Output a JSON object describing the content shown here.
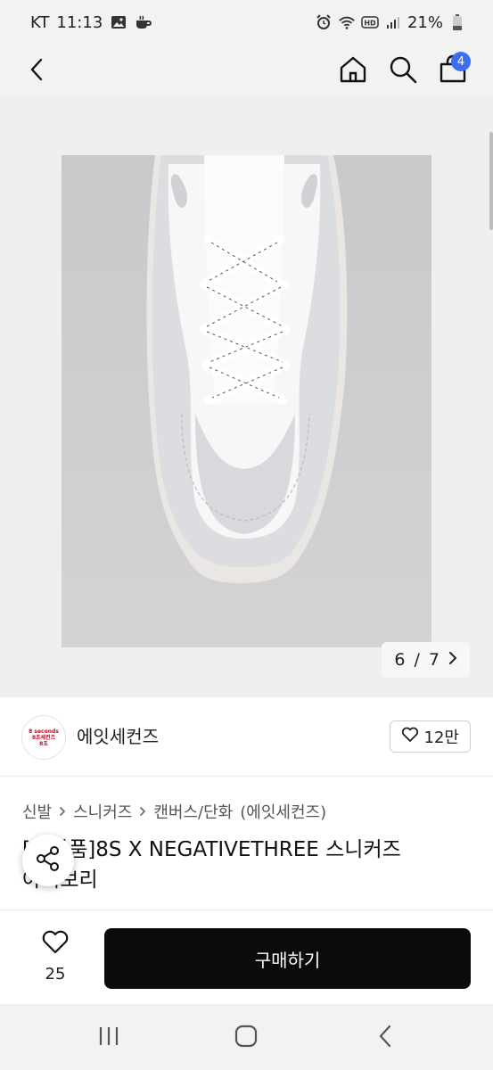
{
  "status_bar": {
    "carrier": "KT",
    "time": "11:13",
    "battery": "21%",
    "icons": [
      "image-icon",
      "coffee-icon",
      "alarm-icon",
      "wifi-icon",
      "hd-icon",
      "signal-icon",
      "battery-icon"
    ]
  },
  "nav": {
    "icons": [
      "back-icon",
      "home-icon",
      "search-icon",
      "cart-icon"
    ],
    "cart_count": "4"
  },
  "gallery": {
    "current": "6",
    "total": "7",
    "separator": "/",
    "image_desc": "white-sneaker-top-view"
  },
  "shop": {
    "logo_lines": [
      "8 seconds",
      "8초세컨즈",
      "8초"
    ],
    "name": "에잇세컨즈",
    "likes": "12만"
  },
  "breadcrumb": [
    "신발",
    "스니커즈",
    "캔버스/단화",
    "(에잇세컨즈)"
  ],
  "product": {
    "title_line1": "[   반품]8S X NEGATIVETHREE 스니커즈",
    "title_line2": "아이보리"
  },
  "bottom": {
    "wish_count": "25",
    "buy_label": "구매하기"
  },
  "colors": {
    "accent": "#3b6ff0",
    "buy_bg": "#0b0b0b",
    "logo_red": "#d0021b"
  }
}
